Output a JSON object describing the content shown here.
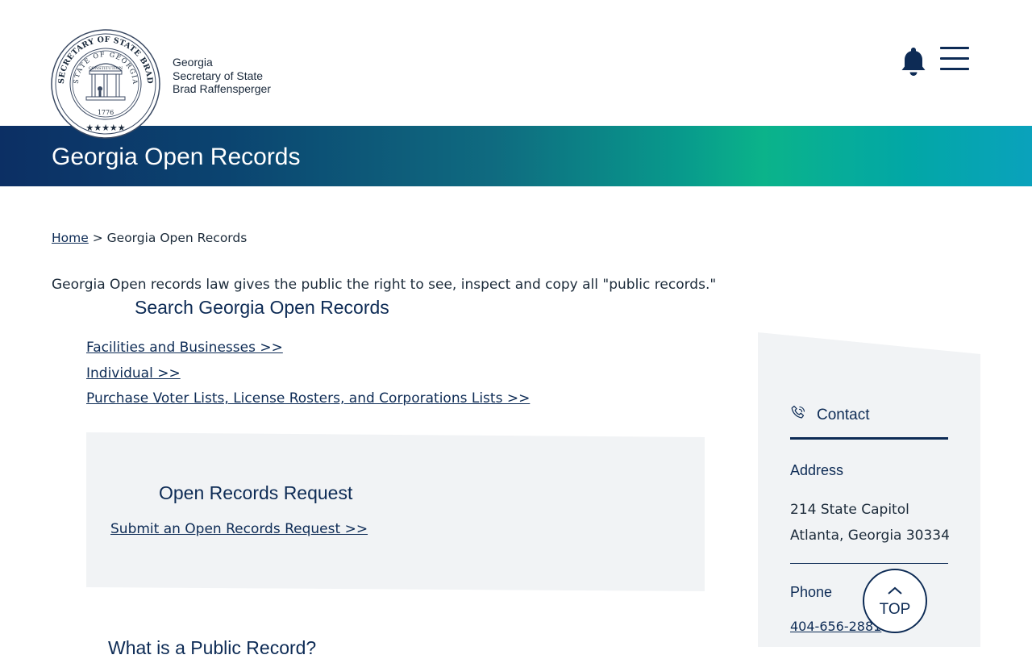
{
  "header": {
    "org_line1": "Georgia",
    "org_line2": "Secretary of State",
    "org_line3": "Brad Raffensperger",
    "seal_text_outer": "SECRETARY OF STATE BRAD RAFFENSPERGER",
    "seal_text_inner": "STATE OF GEORGIA",
    "seal_ribbon": "CONSTITUTION",
    "seal_year": "1776",
    "icons": [
      "bell-icon",
      "hamburger-menu-icon"
    ]
  },
  "banner": {
    "title": "Georgia Open Records"
  },
  "breadcrumb": {
    "home": "Home",
    "separator": ">",
    "current": "Georgia Open Records"
  },
  "main": {
    "intro": "Georgia Open records law gives the public the right to see, inspect and copy all \"public records.\"",
    "search_heading": "Search Georgia Open Records",
    "links": [
      "Facilities and Businesses >>",
      "Individual >>",
      "Purchase Voter Lists, License Rosters, and Corporations Lists >>"
    ],
    "request": {
      "title": "Open Records Request",
      "link": "Submit an Open Records Request >>"
    },
    "next_heading": "What is a Public Record?"
  },
  "sidebar": {
    "contact_label": "Contact",
    "address_heading": "Address",
    "address_line1": "214 State Capitol",
    "address_line2": "Atlanta, Georgia 30334",
    "phone_heading": "Phone",
    "phone_number": "404-656-2881"
  },
  "top_button": {
    "label": "TOP"
  },
  "colors": {
    "navy": "#0d2b55",
    "panel": "#f1f3f5",
    "banner_start": "#0c2f64",
    "banner_mid": "#0bb38a",
    "banner_end": "#0aa2bc"
  }
}
